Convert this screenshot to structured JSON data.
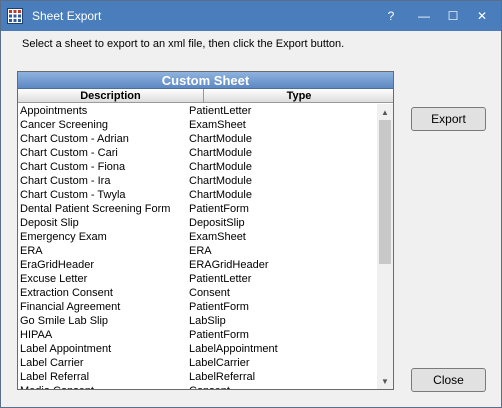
{
  "window": {
    "title": "Sheet Export",
    "help_glyph": "?",
    "minimize_glyph": "—",
    "maximize_glyph": "☐",
    "close_glyph": "✕"
  },
  "instruction": "Select a sheet to export to an xml file, then click the Export button.",
  "grid": {
    "title": "Custom Sheet",
    "columns": [
      "Description",
      "Type"
    ],
    "rows": [
      [
        "Appointments",
        "PatientLetter"
      ],
      [
        "Cancer Screening",
        "ExamSheet"
      ],
      [
        "Chart Custom - Adrian",
        "ChartModule"
      ],
      [
        "Chart Custom - Cari",
        "ChartModule"
      ],
      [
        "Chart Custom - Fiona",
        "ChartModule"
      ],
      [
        "Chart Custom - Ira",
        "ChartModule"
      ],
      [
        "Chart Custom - Twyla",
        "ChartModule"
      ],
      [
        "Dental Patient Screening Form",
        "PatientForm"
      ],
      [
        "Deposit Slip",
        "DepositSlip"
      ],
      [
        "Emergency Exam",
        "ExamSheet"
      ],
      [
        "ERA",
        "ERA"
      ],
      [
        "EraGridHeader",
        "ERAGridHeader"
      ],
      [
        "Excuse Letter",
        "PatientLetter"
      ],
      [
        "Extraction Consent",
        "Consent"
      ],
      [
        "Financial Agreement",
        "PatientForm"
      ],
      [
        "Go Smile Lab Slip",
        "LabSlip"
      ],
      [
        "HIPAA",
        "PatientForm"
      ],
      [
        "Label Appointment",
        "LabelAppointment"
      ],
      [
        "Label Carrier",
        "LabelCarrier"
      ],
      [
        "Label Referral",
        "LabelReferral"
      ],
      [
        "Media Consent",
        "Consent"
      ]
    ],
    "scroll_fraction": 0.57,
    "scroll_up_glyph": "▲",
    "scroll_down_glyph": "▼"
  },
  "buttons": {
    "export_label": "Export",
    "close_label": "Close"
  }
}
